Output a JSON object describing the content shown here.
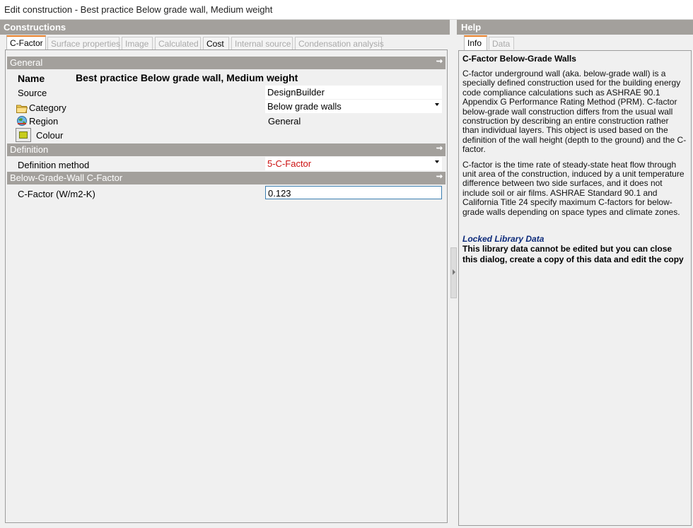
{
  "window": {
    "title": "Edit construction - Best practice Below grade wall, Medium weight"
  },
  "left": {
    "title": "Constructions",
    "tabs": [
      {
        "label": "C-Factor",
        "state": "active"
      },
      {
        "label": "Surface properties",
        "state": "disabled"
      },
      {
        "label": "Image",
        "state": "disabled"
      },
      {
        "label": "Calculated",
        "state": "disabled"
      },
      {
        "label": "Cost",
        "state": "enabled"
      },
      {
        "label": "Internal source",
        "state": "disabled"
      },
      {
        "label": "Condensation analysis",
        "state": "disabled"
      }
    ],
    "sections": {
      "general": {
        "title": "General",
        "name_label": "Name",
        "name_value": "Best practice Below grade wall, Medium weight",
        "source_label": "Source",
        "source_value": "DesignBuilder",
        "category_label": "Category",
        "category_value": "Below grade walls",
        "region_label": "Region",
        "region_value": "General",
        "colour_label": "Colour",
        "colour_value": "#c7cc1c"
      },
      "definition": {
        "title": "Definition",
        "method_label": "Definition method",
        "method_value": "5-C-Factor",
        "method_color": "#cc1111"
      },
      "cfactor": {
        "title": "Below-Grade-Wall C-Factor",
        "cfactor_label": "C-Factor (W/m2-K)",
        "cfactor_value": "0.123"
      }
    }
  },
  "help": {
    "title": "Help",
    "tabs": [
      {
        "label": "Info",
        "state": "active"
      },
      {
        "label": "Data",
        "state": "disabled"
      }
    ],
    "heading": "C-Factor Below-Grade Walls",
    "para1": "C-factor underground wall (aka. below-grade wall) is a specially defined construction used for the building energy code compliance calculations such as ASHRAE 90.1 Appendix G Performance Rating Method (PRM). C-factor below-grade wall construction differs from the usual wall construction by describing an entire construction rather than individual layers. This object is used based on the definition of the wall height (depth to the ground) and the C-factor.",
    "para2": "C-factor is the time rate of steady-state heat flow through unit area of the construction, induced by a unit temperature difference between two side surfaces, and it does not include soil or air films. ASHRAE Standard 90.1 and California Title 24 specify maximum C-factors for below-grade walls depending on space types and climate zones.",
    "locked_title": "Locked Library Data",
    "locked_text": "This library data cannot be edited but you can close this dialog, create a copy of this data and edit the copy"
  },
  "icons": {
    "collapse": "double-chevron-up-icon",
    "category": "folder-icon",
    "region": "region-globe-icon",
    "dropdown": "dropdown-arrow-icon",
    "splitter": "splitter-arrow-icon"
  },
  "colors": {
    "section_header": "#a3a09c",
    "active_tab_accent": "#e8802a",
    "input_focus": "#3c7fb1"
  }
}
